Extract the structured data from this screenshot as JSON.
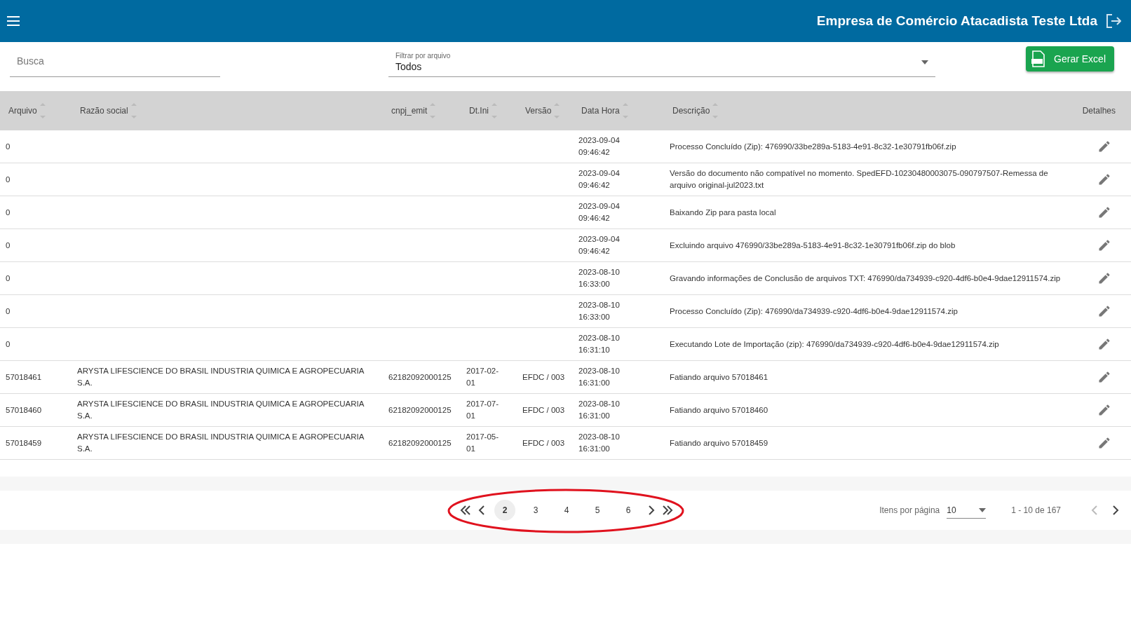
{
  "header": {
    "title": "Empresa de Comércio Atacadista Teste Ltda"
  },
  "filters": {
    "search": {
      "placeholder": "Busca"
    },
    "file_filter": {
      "label": "Filtrar por arquivo",
      "value": "Todos"
    },
    "export_button": "Gerar Excel"
  },
  "table": {
    "columns": [
      {
        "label": "Arquivo",
        "sortable": true
      },
      {
        "label": "Razão social",
        "sortable": true
      },
      {
        "label": "cnpj_emit",
        "sortable": true
      },
      {
        "label": "Dt.Ini",
        "sortable": true
      },
      {
        "label": "Versão",
        "sortable": true
      },
      {
        "label": "Data Hora",
        "sortable": true
      },
      {
        "label": "Descrição",
        "sortable": true
      },
      {
        "label": "Detalhes",
        "sortable": false
      }
    ],
    "rows": [
      {
        "arquivo": "0",
        "razao": "",
        "cnpj": "",
        "dt_ini": "",
        "versao": "",
        "data_hora": [
          "2023-09-04",
          "09:46:42"
        ],
        "descricao": "Processo Concluído (Zip): 476990/33be289a-5183-4e91-8c32-1e30791fb06f.zip"
      },
      {
        "arquivo": "0",
        "razao": "",
        "cnpj": "",
        "dt_ini": "",
        "versao": "",
        "data_hora": [
          "2023-09-04",
          "09:46:42"
        ],
        "descricao": "Versão do documento não compatível no momento. SpedEFD-10230480003075-090797507-Remessa de arquivo original-jul2023.txt"
      },
      {
        "arquivo": "0",
        "razao": "",
        "cnpj": "",
        "dt_ini": "",
        "versao": "",
        "data_hora": [
          "2023-09-04",
          "09:46:42"
        ],
        "descricao": "Baixando Zip para pasta local"
      },
      {
        "arquivo": "0",
        "razao": "",
        "cnpj": "",
        "dt_ini": "",
        "versao": "",
        "data_hora": [
          "2023-09-04",
          "09:46:42"
        ],
        "descricao": "Excluindo arquivo 476990/33be289a-5183-4e91-8c32-1e30791fb06f.zip do blob"
      },
      {
        "arquivo": "0",
        "razao": "",
        "cnpj": "",
        "dt_ini": "",
        "versao": "",
        "data_hora": [
          "2023-08-10",
          "16:33:00"
        ],
        "descricao": "Gravando informações de Conclusão de arquivos TXT: 476990/da734939-c920-4df6-b0e4-9dae12911574.zip"
      },
      {
        "arquivo": "0",
        "razao": "",
        "cnpj": "",
        "dt_ini": "",
        "versao": "",
        "data_hora": [
          "2023-08-10",
          "16:33:00"
        ],
        "descricao": "Processo Concluído (Zip): 476990/da734939-c920-4df6-b0e4-9dae12911574.zip"
      },
      {
        "arquivo": "0",
        "razao": "",
        "cnpj": "",
        "dt_ini": "",
        "versao": "",
        "data_hora": [
          "2023-08-10",
          "16:31:10"
        ],
        "descricao": "Executando Lote de Importação (zip): 476990/da734939-c920-4df6-b0e4-9dae12911574.zip"
      },
      {
        "arquivo": "57018461",
        "razao": "ARYSTA LIFESCIENCE DO BRASIL INDUSTRIA QUIMICA E AGROPECUARIA S.A.",
        "cnpj": "62182092000125",
        "dt_ini": "2017-02-01",
        "versao": "EFDC / 003",
        "data_hora": [
          "2023-08-10",
          "16:31:00"
        ],
        "descricao": "Fatiando arquivo 57018461"
      },
      {
        "arquivo": "57018460",
        "razao": "ARYSTA LIFESCIENCE DO BRASIL INDUSTRIA QUIMICA E AGROPECUARIA S.A.",
        "cnpj": "62182092000125",
        "dt_ini": "2017-07-01",
        "versao": "EFDC / 003",
        "data_hora": [
          "2023-08-10",
          "16:31:00"
        ],
        "descricao": "Fatiando arquivo 57018460"
      },
      {
        "arquivo": "57018459",
        "razao": "ARYSTA LIFESCIENCE DO BRASIL INDUSTRIA QUIMICA E AGROPECUARIA S.A.",
        "cnpj": "62182092000125",
        "dt_ini": "2017-05-01",
        "versao": "EFDC / 003",
        "data_hora": [
          "2023-08-10",
          "16:31:00"
        ],
        "descricao": "Fatiando arquivo 57018459"
      }
    ]
  },
  "pagination": {
    "pages": [
      {
        "label": "2",
        "selected": true
      },
      {
        "label": "3",
        "selected": false
      },
      {
        "label": "4",
        "selected": false
      },
      {
        "label": "5",
        "selected": false
      },
      {
        "label": "6",
        "selected": false
      }
    ],
    "highlight": {
      "kind": "ellipse"
    },
    "page_size_label": "Itens por página",
    "page_size": "10",
    "range": "1 - 10 de 167",
    "prev_disabled": true,
    "next_disabled": false
  }
}
